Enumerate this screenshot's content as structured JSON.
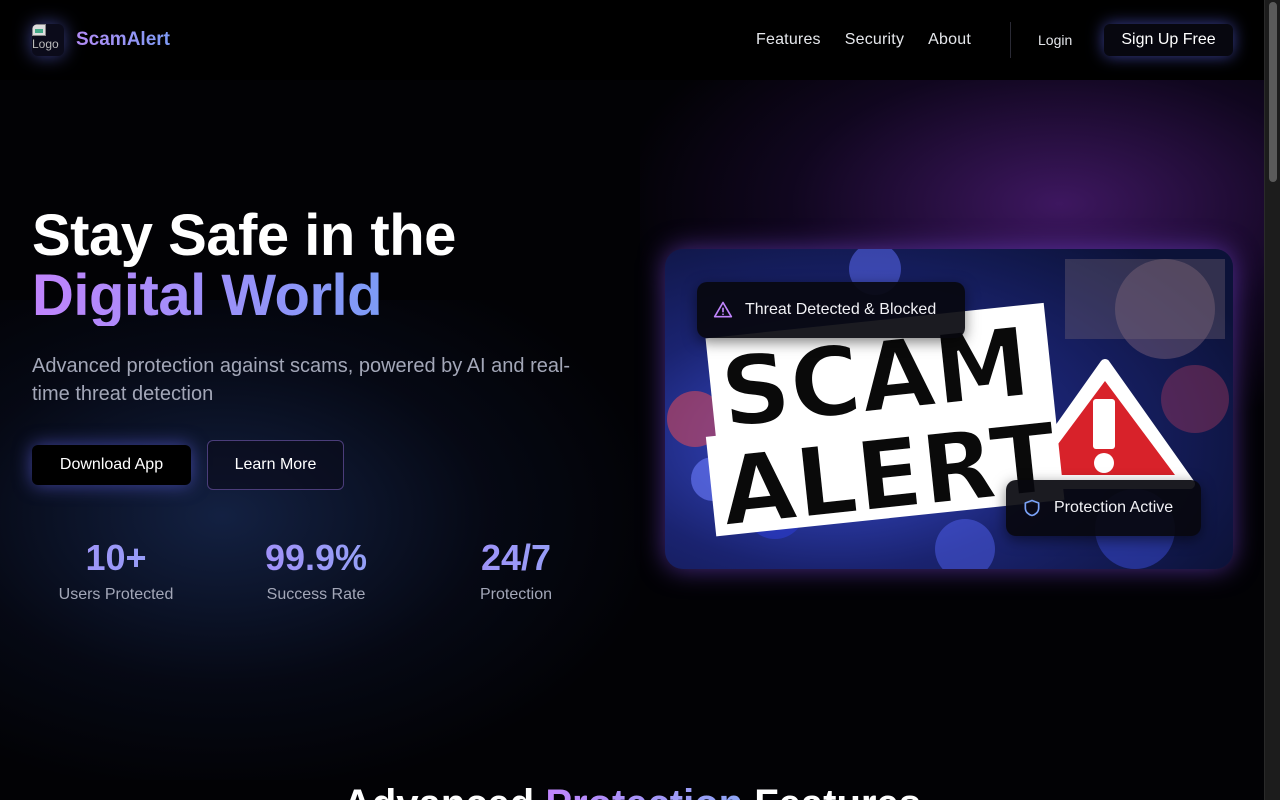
{
  "header": {
    "logo_alt": "Logo",
    "brand": "ScamAlert",
    "nav": [
      "Features",
      "Security",
      "About"
    ],
    "login": "Login",
    "signup": "Sign Up Free"
  },
  "hero": {
    "title_line1": "Stay Safe in the",
    "title_line2": "Digital World",
    "subtitle": "Advanced protection against scams, powered by AI and real-time threat detection",
    "download_button": "Download App",
    "learn_button": "Learn More",
    "stats": [
      {
        "value": "10+",
        "label": "Users Protected"
      },
      {
        "value": "99.9%",
        "label": "Success Rate"
      },
      {
        "value": "24/7",
        "label": "Protection"
      }
    ],
    "image_text_line1": "SCAM",
    "image_text_line2": "ALERT",
    "badge_threat": "Threat Detected & Blocked",
    "badge_protection": "Protection Active"
  },
  "features_section": {
    "title_part1": "Advanced",
    "title_part2": "Protection",
    "title_part3": "Features"
  },
  "colors": {
    "accent_purple": "#c084fc",
    "accent_blue": "#6ea0f5",
    "threat_icon": "#c084fc",
    "shield_icon": "#7aa2f7"
  },
  "icons": {
    "threat": "warning-triangle-icon",
    "protection": "shield-icon"
  }
}
